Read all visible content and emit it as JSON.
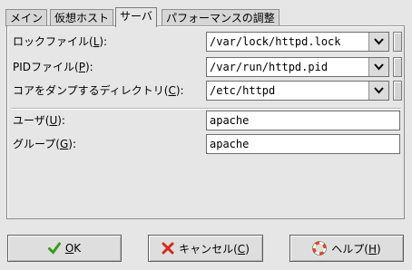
{
  "tabs": [
    {
      "label": "メイン",
      "active": false
    },
    {
      "label": "仮想ホスト",
      "active": false
    },
    {
      "label": "サーバ",
      "active": true
    },
    {
      "label": "パフォーマンスの調整",
      "active": false
    }
  ],
  "server": {
    "lock_file": {
      "label": "ロックファイル(",
      "mnemonic": "L",
      "suffix": "):",
      "value": "/var/lock/httpd.lock"
    },
    "pid_file": {
      "label": "PIDファイル(",
      "mnemonic": "P",
      "suffix": "):",
      "value": "/var/run/httpd.pid"
    },
    "core_dir": {
      "label": "コアをダンプするディレクトリ(",
      "mnemonic": "C",
      "suffix": "):",
      "value": "/etc/httpd"
    },
    "user": {
      "label": "ユーザ(",
      "mnemonic": "U",
      "suffix": "):",
      "value": "apache"
    },
    "group": {
      "label": "グループ(",
      "mnemonic": "G",
      "suffix": "):",
      "value": "apache"
    }
  },
  "buttons": {
    "ok": {
      "pre": "",
      "mnemonic": "O",
      "post": "K"
    },
    "cancel": {
      "pre": "キャンセル(",
      "mnemonic": "C",
      "post": ")"
    },
    "help": {
      "pre": "ヘルプ(",
      "mnemonic": "H",
      "post": ")"
    }
  },
  "colors": {
    "ok_check": "#3a9a1e",
    "cancel_x": "#d22a1e",
    "help_ring": "#e04a1a"
  }
}
